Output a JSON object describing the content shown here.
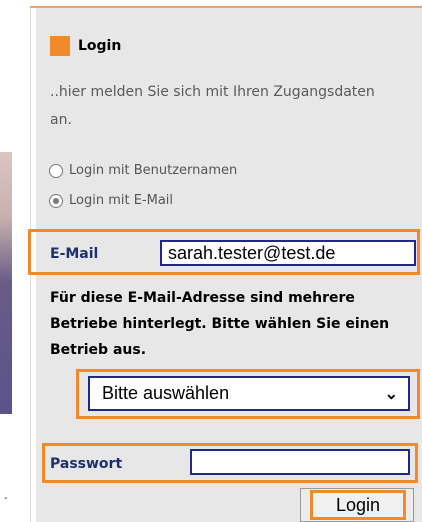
{
  "login": {
    "title": "Login",
    "intro": "..hier melden Sie sich mit Ihren Zugangsdaten an."
  },
  "radios": [
    {
      "label": "Login mit Benutzernamen",
      "checked": false
    },
    {
      "label": "Login mit E-Mail",
      "checked": true
    }
  ],
  "email": {
    "label": "E-Mail",
    "value": "sarah.tester@test.de"
  },
  "info": "Für diese E-Mail-Adresse sind mehrere Betriebe hinterlegt. Bitte wählen Sie einen Betrieb aus.",
  "select": {
    "value": "Bitte auswählen"
  },
  "password": {
    "label": "Passwort",
    "value": ""
  },
  "buttons": {
    "login": "Login"
  },
  "misc": {
    "left_marker": "-"
  },
  "colors": {
    "accent": "#f28a2b",
    "label_blue": "#1c2f6e",
    "field_border": "#1f2a88",
    "panel_bg": "#e7e7e7"
  }
}
